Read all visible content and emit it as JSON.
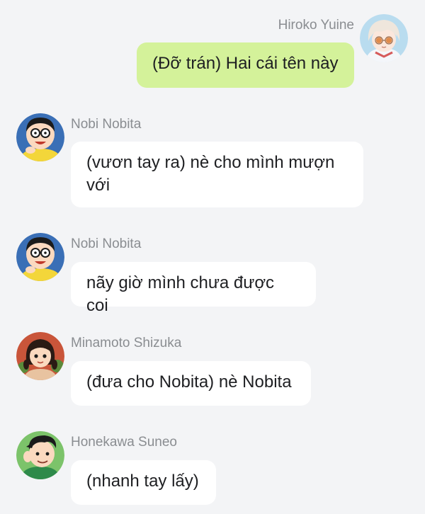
{
  "messages": [
    {
      "sender": "Hiroko Yuine",
      "text": "(Đỡ trán) Hai cái tên này",
      "side": "right",
      "avatar": "hiroko-avatar"
    },
    {
      "sender": "Nobi Nobita",
      "text": "(vươn tay ra) nè cho mình mượn với",
      "side": "left",
      "avatar": "nobita-avatar"
    },
    {
      "sender": "Nobi Nobita",
      "text": "nãy giờ mình chưa được coi",
      "side": "left",
      "avatar": "nobita-avatar"
    },
    {
      "sender": "Minamoto Shizuka",
      "text": "(đưa cho Nobita) nè Nobita",
      "side": "left",
      "avatar": "shizuka-avatar"
    },
    {
      "sender": "Honekawa Suneo",
      "text": "(nhanh tay lấy)",
      "side": "left",
      "avatar": "suneo-avatar"
    }
  ],
  "colors": {
    "background": "#f3f4f6",
    "bubble_incoming": "#ffffff",
    "bubble_outgoing": "#d4f29a",
    "sender_name": "#8a8d91",
    "message_text": "#1e1f22"
  }
}
